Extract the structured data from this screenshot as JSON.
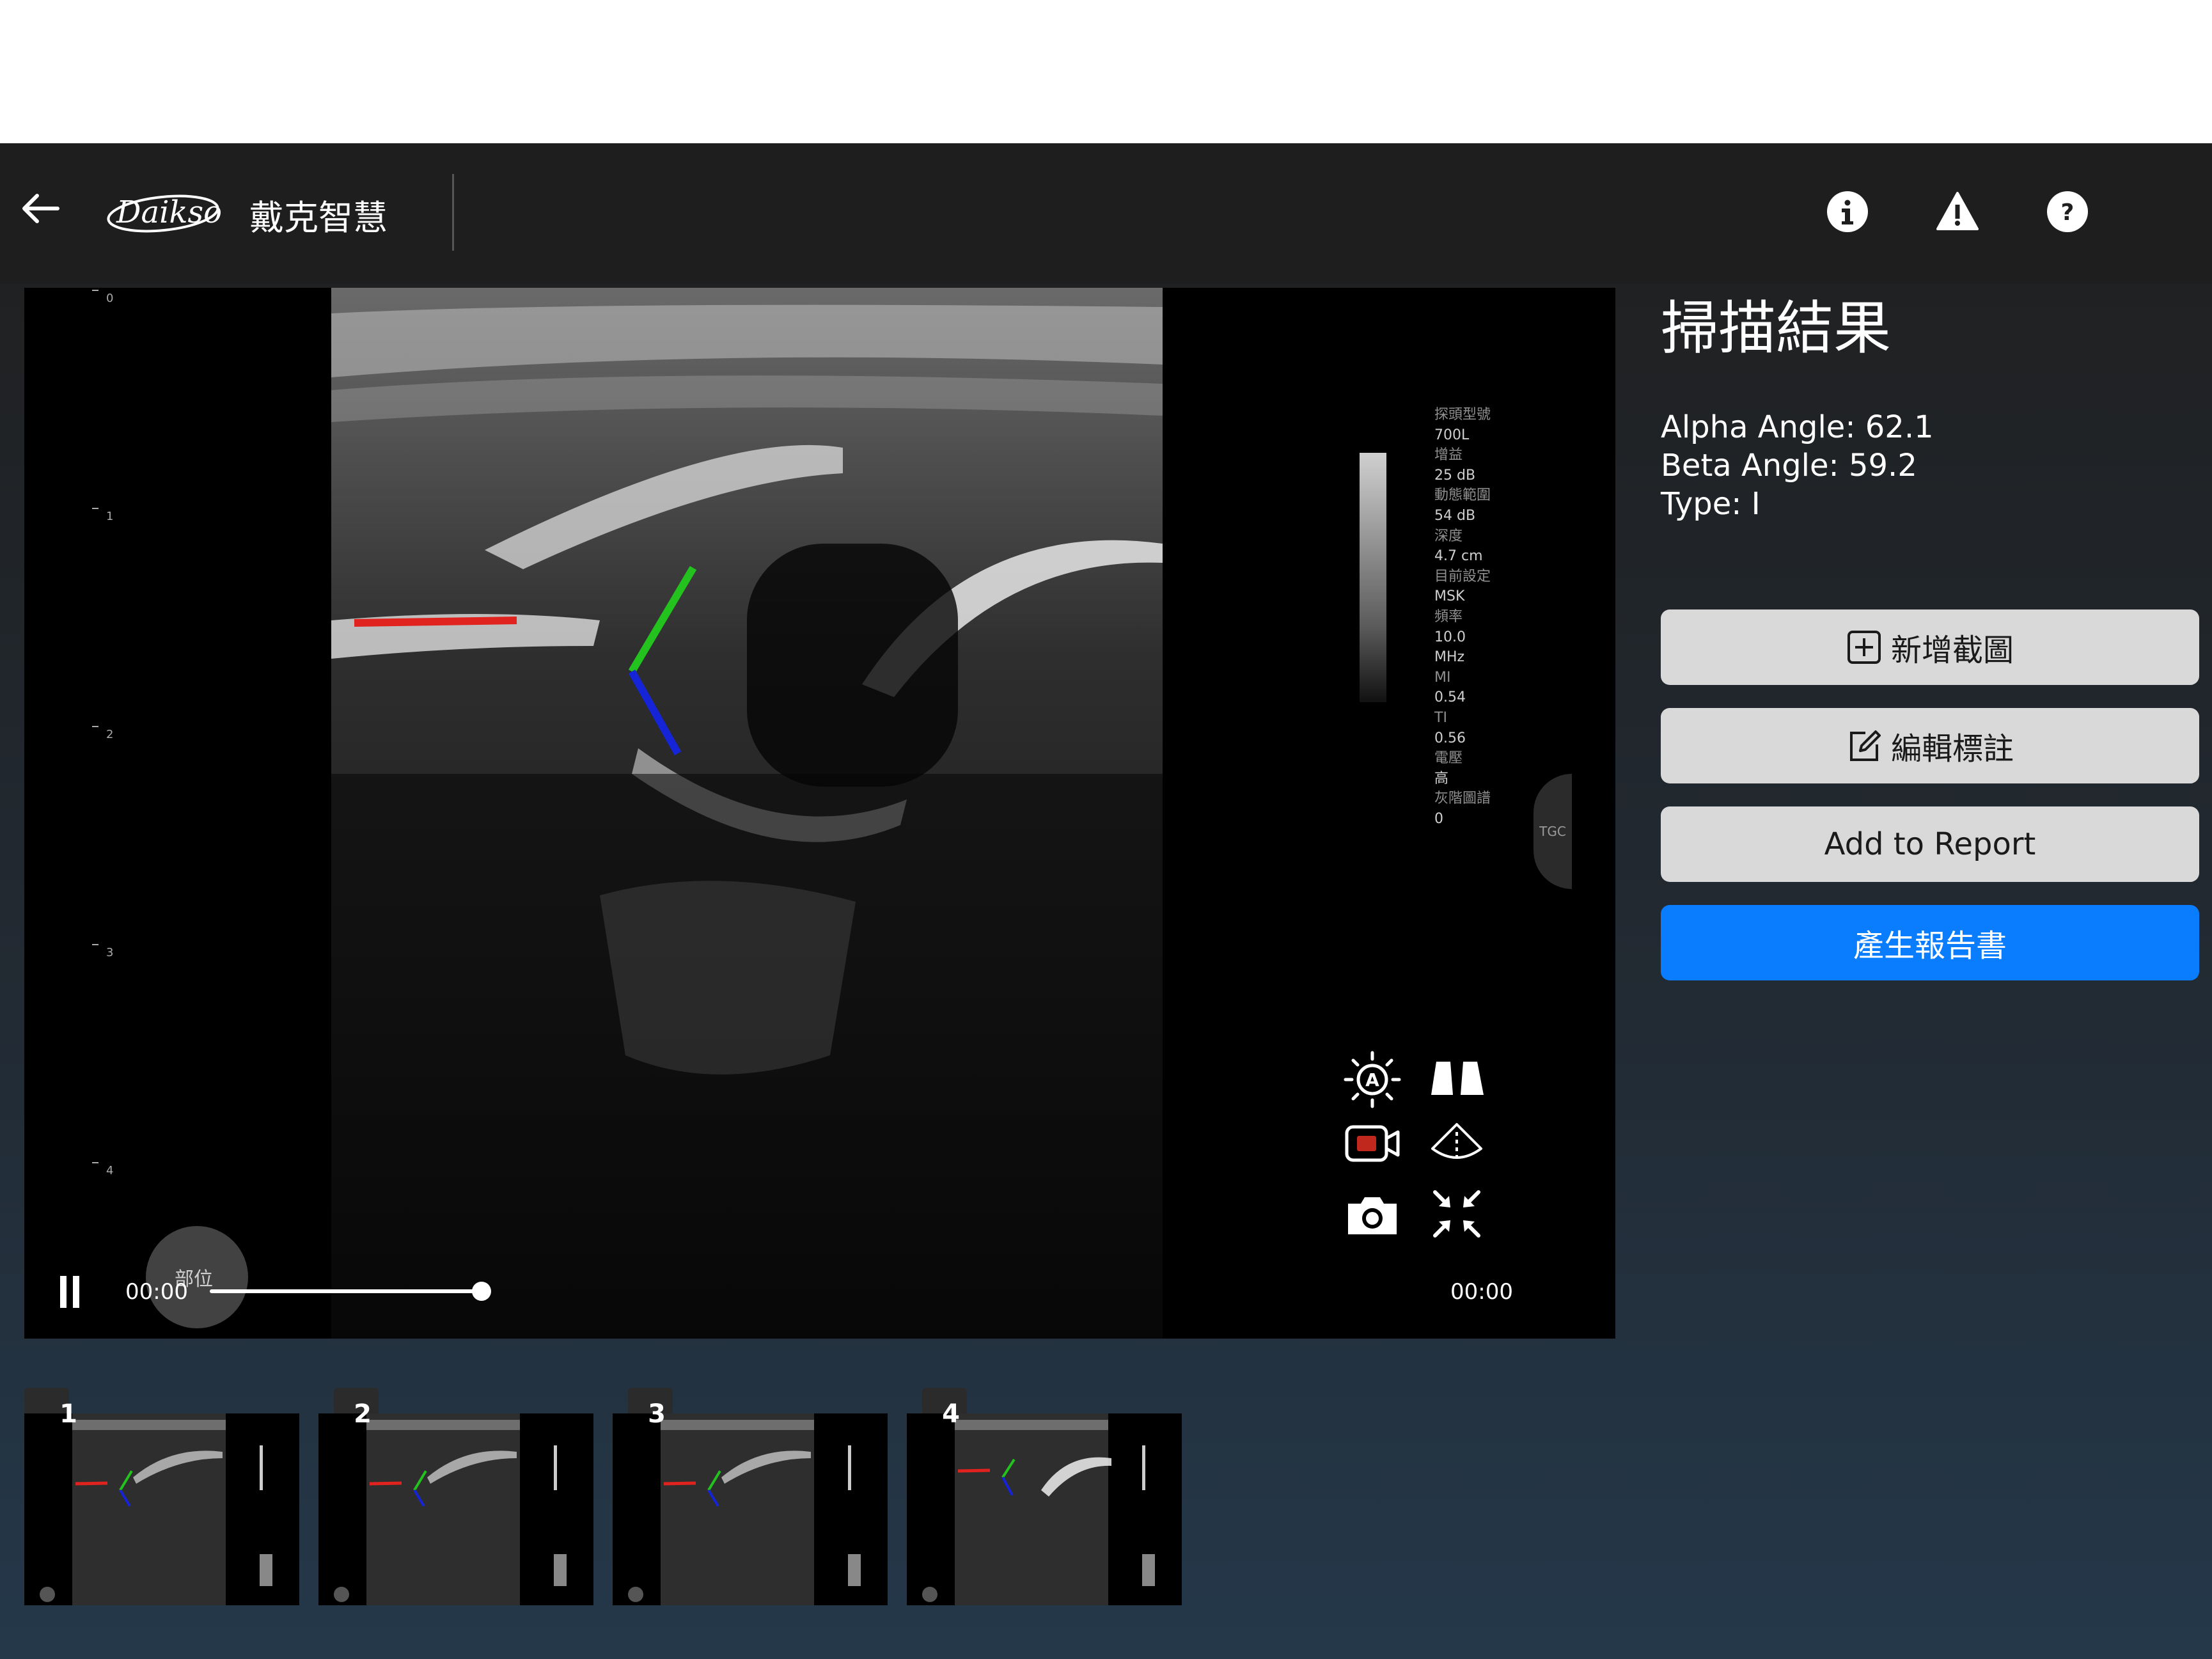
{
  "header": {
    "brand_name": "戴克智慧",
    "logo_text": "Daikso"
  },
  "viewer": {
    "params": [
      "探頭型號",
      "700L",
      "增益",
      "25 dB",
      "動態範圍",
      "54 dB",
      "深度",
      "4.7 cm",
      "目前設定",
      "MSK",
      "頻率",
      "10.0",
      "MHz",
      "MI",
      "0.54",
      "TI",
      "0.56",
      "電壓",
      "高",
      "灰階圖譜",
      "0"
    ],
    "depth_ticks": [
      "0",
      "1",
      "2",
      "3",
      "4"
    ],
    "tgc_label": "TGC",
    "bubble_label": "部位",
    "time_current": "00:00",
    "time_total": "00:00",
    "playback_progress": 1.0
  },
  "panel": {
    "title": "掃描結果",
    "alpha": "Alpha Angle: 62.1",
    "beta": "Beta Angle: 59.2",
    "type": "Type: I",
    "buttons": {
      "add_screenshot": "新增截圖",
      "edit_annotation": "編輯標註",
      "add_to_report": "Add to Report",
      "generate_report": "產生報告書"
    }
  },
  "thumbnails": [
    "1",
    "2",
    "3",
    "4"
  ],
  "colors": {
    "primary_button": "#0a7dff",
    "baseline_line": "#e0231e",
    "alpha_line": "#23c21e",
    "beta_line": "#1424d6"
  }
}
